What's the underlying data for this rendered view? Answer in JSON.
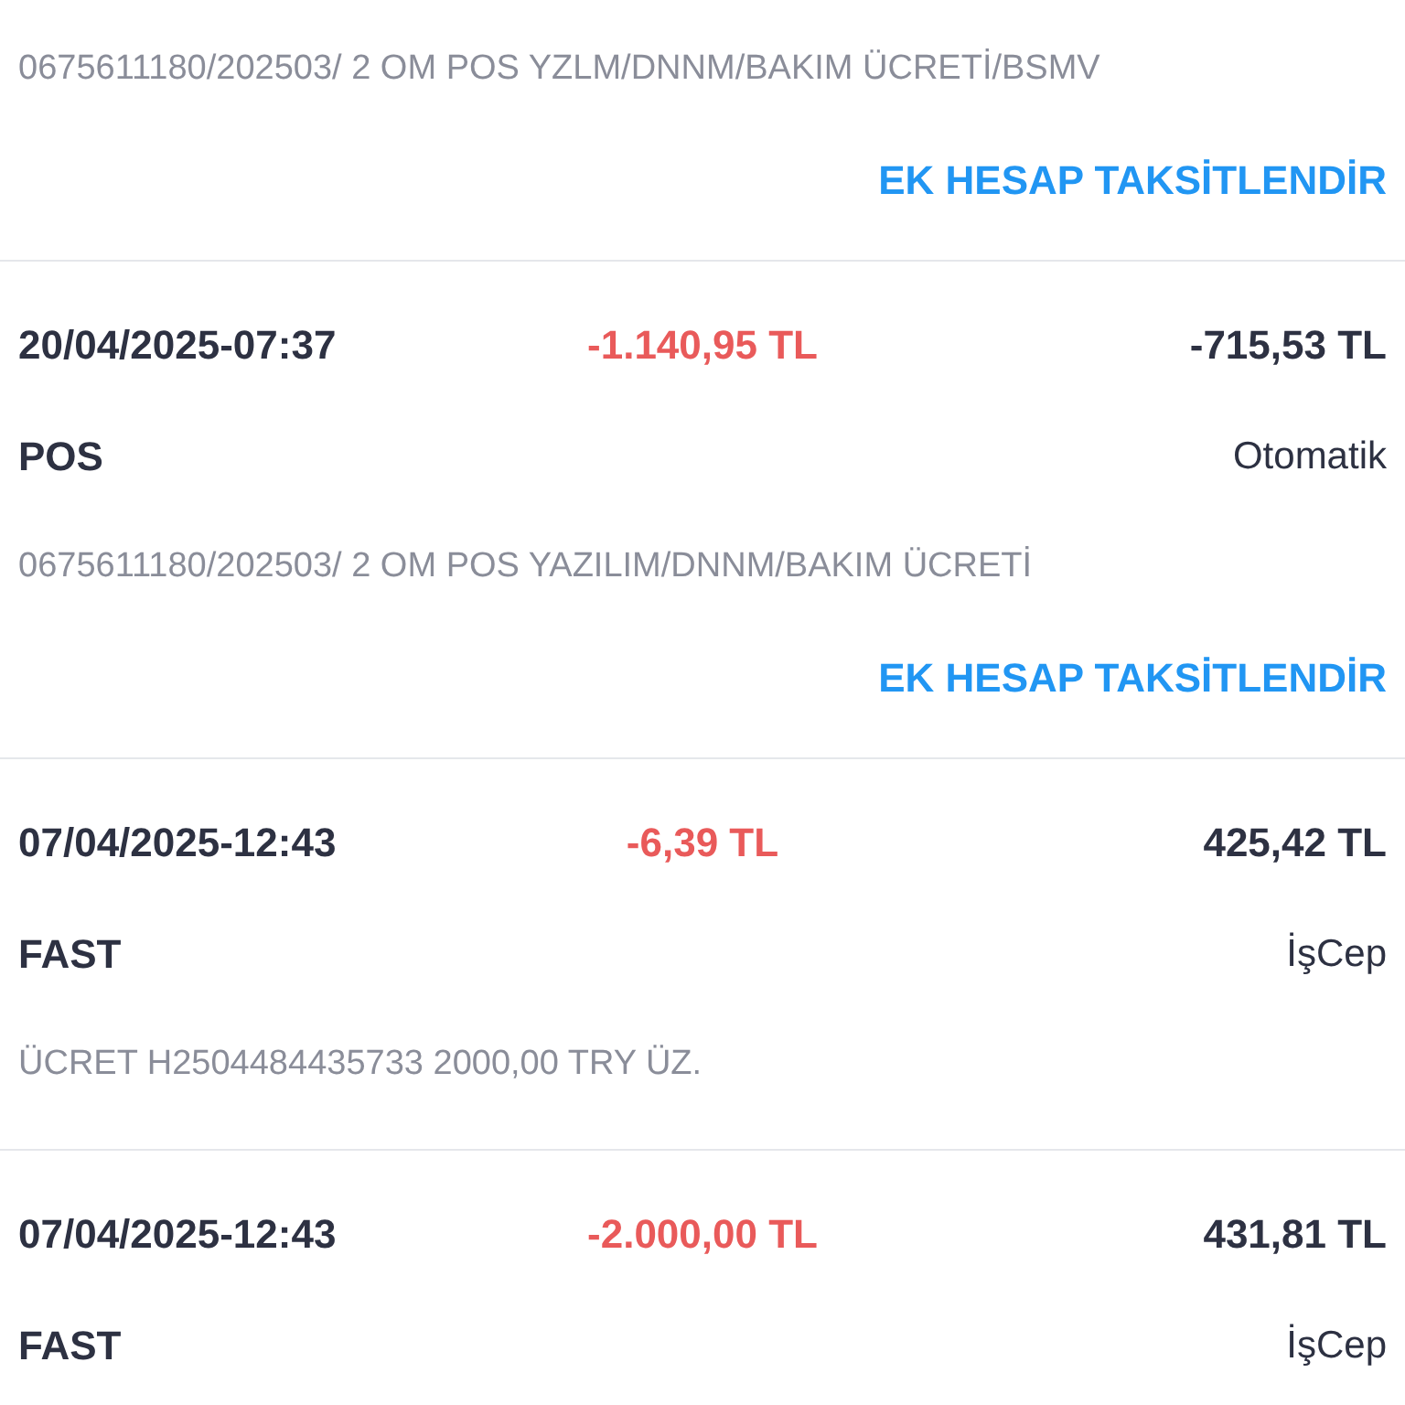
{
  "transactions": [
    {
      "description": "0675611180/202503/ 2 OM POS YZLM/DNNM/BAKIM ÜCRETİ/BSMV",
      "action": "EK HESAP TAKSİTLENDİR"
    },
    {
      "date": "20/04/2025-07:37",
      "amount": "-1.140,95 TL",
      "balance": "-715,53 TL",
      "type": "POS",
      "channel": "Otomatik",
      "description": "0675611180/202503/ 2 OM POS YAZILIM/DNNM/BAKIM ÜCRETİ",
      "action": "EK HESAP TAKSİTLENDİR"
    },
    {
      "date": "07/04/2025-12:43",
      "amount": "-6,39 TL",
      "balance": "425,42 TL",
      "type": "FAST",
      "channel": "İşCep",
      "description": "ÜCRET H2504484435733 2000,00 TRY ÜZ."
    },
    {
      "date": "07/04/2025-12:43",
      "amount": "-2.000,00 TL",
      "balance": "431,81 TL",
      "type": "FAST",
      "channel": "İşCep"
    }
  ]
}
